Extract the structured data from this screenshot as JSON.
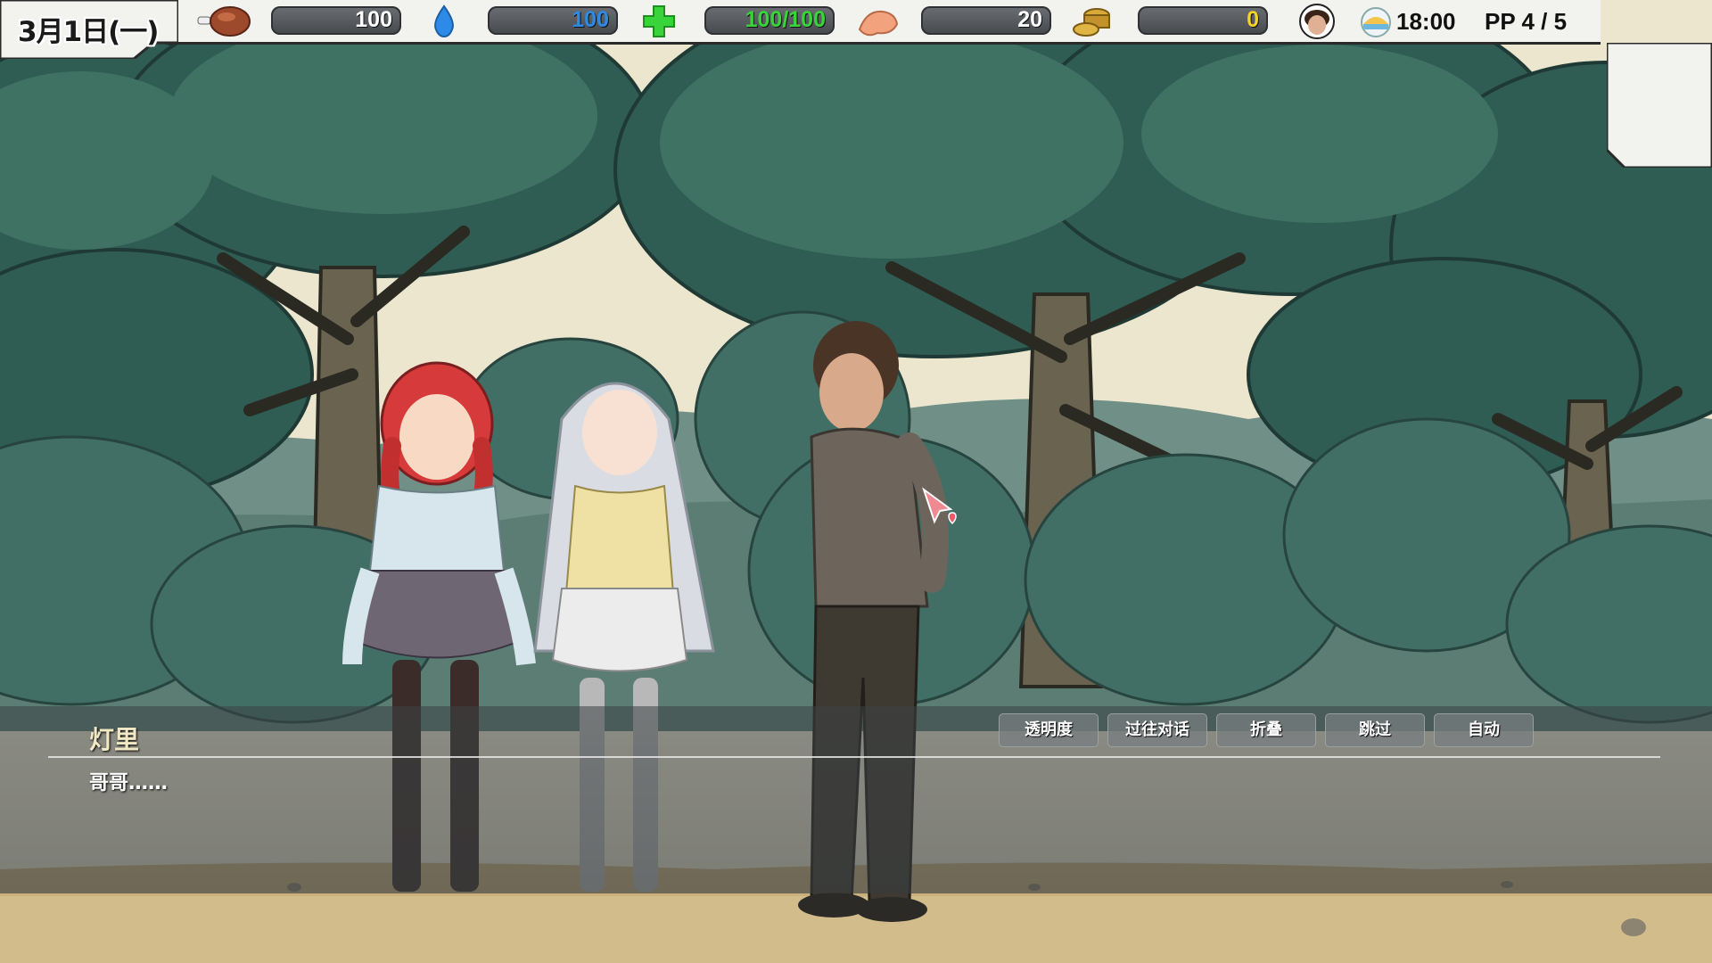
{
  "hud": {
    "date": "3月1日(一)",
    "food": {
      "value": "100",
      "color": "#ffffff"
    },
    "water": {
      "value": "100",
      "color": "#2d8ae6"
    },
    "health": {
      "value": "100/100",
      "color": "#39d43a"
    },
    "strength": {
      "value": "20",
      "color": "#ffffff"
    },
    "money": {
      "value": "0",
      "color": "#f3d32a"
    },
    "time": "18:00",
    "pp": "PP 4 / 5"
  },
  "dialogue": {
    "speaker": "灯里",
    "text": "哥哥……",
    "buttons": [
      "透明度",
      "过往对话",
      "折叠",
      "跳过",
      "自动"
    ]
  },
  "colors": {
    "sky": "#ece6cf",
    "tree_dark": "#2f5c53",
    "tree_mid": "#3f7263",
    "ground": "#c9b07d"
  }
}
